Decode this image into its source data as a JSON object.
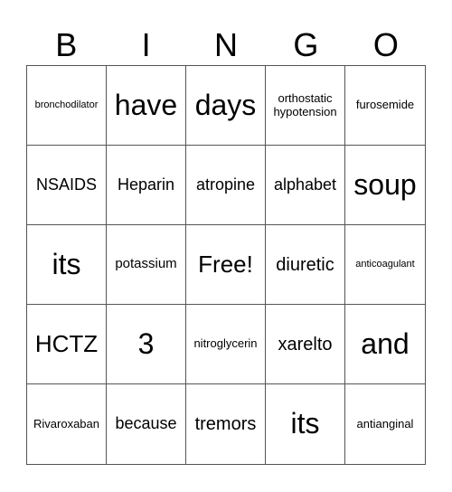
{
  "header": [
    "B",
    "I",
    "N",
    "G",
    "O"
  ],
  "cells": [
    {
      "text": "bronchodilator",
      "size": "s-xs"
    },
    {
      "text": "have",
      "size": "s-huge"
    },
    {
      "text": "days",
      "size": "s-huge"
    },
    {
      "text": "orthostatic hypotension",
      "size": "s-sm"
    },
    {
      "text": "furosemide",
      "size": "s-sm"
    },
    {
      "text": "NSAIDS",
      "size": "s-lg"
    },
    {
      "text": "Heparin",
      "size": "s-lg"
    },
    {
      "text": "atropine",
      "size": "s-lg"
    },
    {
      "text": "alphabet",
      "size": "s-lg"
    },
    {
      "text": "soup",
      "size": "s-huge"
    },
    {
      "text": "its",
      "size": "s-huge"
    },
    {
      "text": "potassium",
      "size": "s-md"
    },
    {
      "text": "Free!",
      "size": "s-xxl"
    },
    {
      "text": "diuretic",
      "size": "s-xl"
    },
    {
      "text": "anticoagulant",
      "size": "s-xs"
    },
    {
      "text": "HCTZ",
      "size": "s-xxl"
    },
    {
      "text": "3",
      "size": "s-huge"
    },
    {
      "text": "nitroglycerin",
      "size": "s-sm"
    },
    {
      "text": "xarelto",
      "size": "s-xl"
    },
    {
      "text": "and",
      "size": "s-huge"
    },
    {
      "text": "Rivaroxaban",
      "size": "s-sm"
    },
    {
      "text": "because",
      "size": "s-lg"
    },
    {
      "text": "tremors",
      "size": "s-xl"
    },
    {
      "text": "its",
      "size": "s-huge"
    },
    {
      "text": "antianginal",
      "size": "s-sm"
    }
  ]
}
